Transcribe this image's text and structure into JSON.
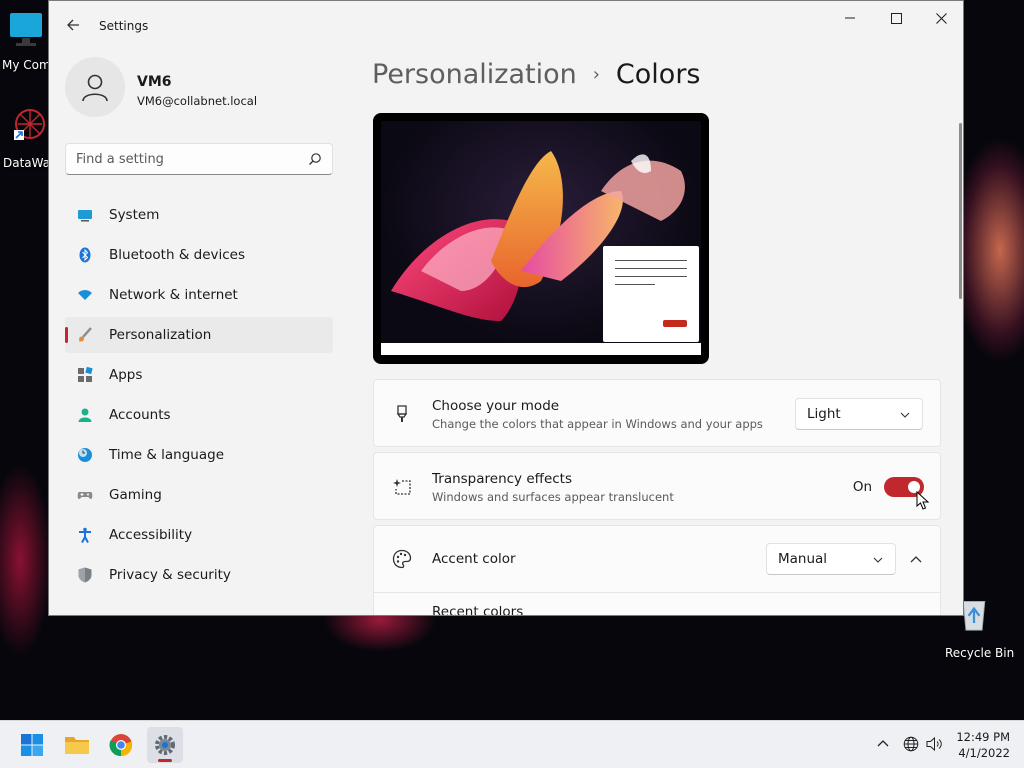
{
  "desktop": {
    "icons": [
      {
        "label": "My Com"
      },
      {
        "label": "DataWag"
      },
      {
        "label": "Recycle Bin"
      }
    ]
  },
  "window": {
    "app_title": "Settings",
    "controls": {
      "minimize": "minimize-icon",
      "maximize": "maximize-icon",
      "close": "close-icon"
    }
  },
  "profile": {
    "name": "VM6",
    "email": "VM6@collabnet.local"
  },
  "search": {
    "placeholder": "Find a setting",
    "value": ""
  },
  "sidebar": {
    "items": [
      {
        "label": "System",
        "icon": "system-icon"
      },
      {
        "label": "Bluetooth & devices",
        "icon": "bluetooth-icon"
      },
      {
        "label": "Network & internet",
        "icon": "wifi-icon"
      },
      {
        "label": "Personalization",
        "icon": "brush-icon",
        "active": true
      },
      {
        "label": "Apps",
        "icon": "apps-icon"
      },
      {
        "label": "Accounts",
        "icon": "accounts-icon"
      },
      {
        "label": "Time & language",
        "icon": "clock-globe-icon"
      },
      {
        "label": "Gaming",
        "icon": "gamepad-icon"
      },
      {
        "label": "Accessibility",
        "icon": "accessibility-icon"
      },
      {
        "label": "Privacy & security",
        "icon": "shield-icon"
      }
    ]
  },
  "header": {
    "breadcrumb_parent": "Personalization",
    "breadcrumb_separator": "›",
    "title": "Colors"
  },
  "settings": {
    "mode": {
      "title": "Choose your mode",
      "subtitle": "Change the colors that appear in Windows and your apps",
      "value": "Light"
    },
    "transparency": {
      "title": "Transparency effects",
      "subtitle": "Windows and surfaces appear translucent",
      "state": "On"
    },
    "accent": {
      "title": "Accent color",
      "value": "Manual"
    },
    "recent_colors": {
      "title": "Recent colors"
    }
  },
  "taskbar": {
    "apps": [
      "start-icon",
      "file-explorer-icon",
      "chrome-icon",
      "settings-icon"
    ],
    "time": "12:49 PM",
    "date": "4/1/2022"
  },
  "colors": {
    "accent": "#c0282d",
    "window_bg": "#f3f3f3",
    "card_bg": "#fbfbfb"
  }
}
